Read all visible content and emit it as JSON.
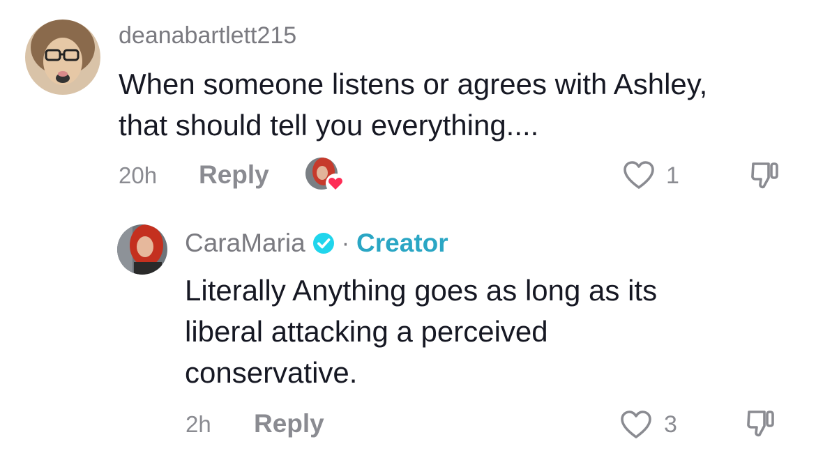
{
  "comment": {
    "username": "deanabartlett215",
    "text_line1": "When someone listens or agrees with Ashley,",
    "text_line2": "that should tell you everything....",
    "time": "20h",
    "reply_label": "Reply",
    "like_count": "1"
  },
  "reply": {
    "username": "CaraMaria",
    "badge_separator": "·",
    "creator_label": "Creator",
    "text_line1": "Literally Anything goes as long as its",
    "text_line2": "liberal attacking a perceived",
    "text_line3": "conservative.",
    "time": "2h",
    "reply_label": "Reply",
    "like_count": "3"
  },
  "icons": {
    "like": "heart-outline-icon",
    "dislike": "thumbs-down-icon",
    "verified": "verified-check-icon",
    "creator_liked": "heart-filled-icon"
  },
  "colors": {
    "creator_accent": "#2aa6c4",
    "like_badge": "#fe2c55",
    "muted_text": "#8a8b91",
    "body_text": "#161823"
  }
}
